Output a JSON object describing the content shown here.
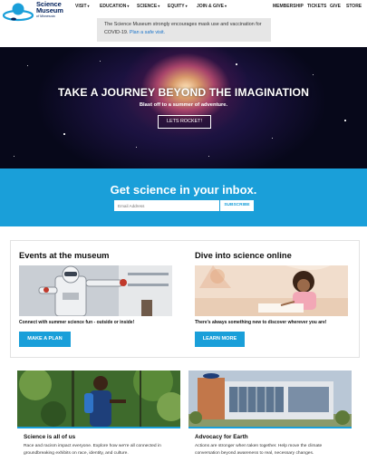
{
  "header": {
    "logo": {
      "line1": "Science",
      "line2": "Museum",
      "line3": "of Minnesota"
    },
    "nav": [
      "VISIT",
      "EDUCATION",
      "SCIENCE",
      "EQUITY",
      "JOIN & GIVE"
    ],
    "util": [
      "MEMBERSHIP",
      "TICKETS",
      "GIVE",
      "STORE"
    ]
  },
  "notice": {
    "text": "The Science Museum strongly encourages mask use and vaccination for COVID-19.",
    "link": "Plan a safe visit."
  },
  "hero": {
    "title": "TAKE A JOURNEY BEYOND THE IMAGINATION",
    "subtitle": "Blast off to a summer of adventure.",
    "button": "LETS ROCKET!"
  },
  "newsletter": {
    "title": "Get science in your inbox.",
    "placeholder": "Email Address",
    "button": "SUBSCRIBE"
  },
  "events": {
    "title": "Events at the museum",
    "text": "Connect with summer science fun - outside or inside!",
    "button": "MAKE A PLAN"
  },
  "online": {
    "title": "Dive into science online",
    "text": "There's always something new to discover wherever you are!",
    "button": "LEARN MORE"
  },
  "science_for_all": {
    "title": "Science is all of us",
    "text": "Race and racism impact everyone. Explore how we're all connected in groundbreaking exhibits on race, identity, and culture."
  },
  "earth": {
    "title": "Advocacy for Earth",
    "text": "Actions are stronger when taken together. Help move the climate conversation beyond awareness to real, necessary changes."
  },
  "colors": {
    "accent": "#1a9fd9",
    "navy": "#00205b"
  }
}
